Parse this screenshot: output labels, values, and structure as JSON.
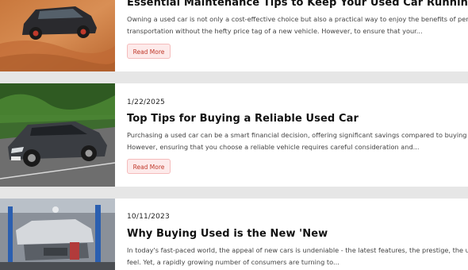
{
  "posts": [
    {
      "date": "",
      "title": "Essential Maintenance Tips to Keep Your Used Car Running Smoothly",
      "excerpt_line1": "Owning a used car is not only a cost-effective choice but also a practical way to enjoy the benefits of personal",
      "excerpt_line2": "transportation without the hefty price tag of a new vehicle. However, to ensure that your...",
      "read_more": "Read More",
      "image": "dark-suv-desert-photo"
    },
    {
      "date": "1/22/2025",
      "title": "Top Tips for Buying a Reliable Used Car",
      "excerpt_line1": "Purchasing a used car can be a smart financial decision, offering significant savings compared to buying new.",
      "excerpt_line2": "However, ensuring that you choose a reliable vehicle requires careful consideration and...",
      "read_more": "Read More",
      "image": "gray-sedan-road-photo"
    },
    {
      "date": "10/11/2023",
      "title": "Why Buying Used is the New 'New",
      "excerpt_line1": "In today's fast-paced world, the appeal of new cars is undeniable - the latest features, the prestige, the untouched",
      "excerpt_line2": "feel. Yet, a rapidly growing number of consumers are turning to...",
      "read_more": "",
      "image": "car-lift-garage-photo"
    }
  ],
  "colors": {
    "page_bg": "#e6e6e6",
    "card_bg": "#ffffff",
    "button_bg": "#fdeaea",
    "button_text": "#c0392b"
  }
}
